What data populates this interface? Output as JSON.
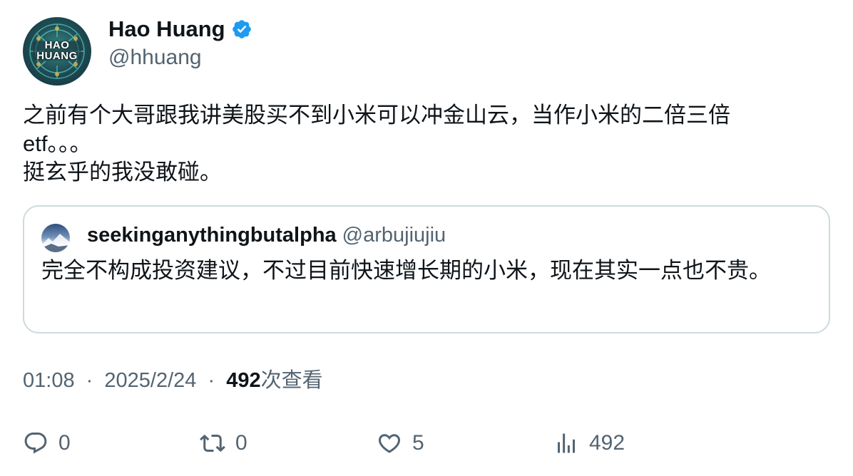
{
  "author": {
    "display_name": "Hao Huang",
    "handle": "@hhuang",
    "avatar_text": "HAO HUANG",
    "verified_color": "#1d9bf0"
  },
  "body": {
    "lines": [
      "之前有个大哥跟我讲美股买不到小米可以冲金山云，当作小米的二倍三倍",
      "etf。。。",
      "挺玄乎的我没敢碰。"
    ]
  },
  "quote": {
    "display_name": "seekinganythingbutalpha",
    "handle": "@arbujiujiu",
    "text": "完全不构成投资建议，不过目前快速增长期的小米，现在其实一点也不贵。"
  },
  "meta": {
    "time": "01:08",
    "separator": "·",
    "date": "2025/2/24",
    "views_count": "492",
    "views_label": "次查看"
  },
  "actions": {
    "replies": "0",
    "reposts": "0",
    "likes": "5",
    "views": "492"
  },
  "colors": {
    "text": "#0f1419",
    "secondary": "#536471",
    "border": "#cfd9de"
  }
}
